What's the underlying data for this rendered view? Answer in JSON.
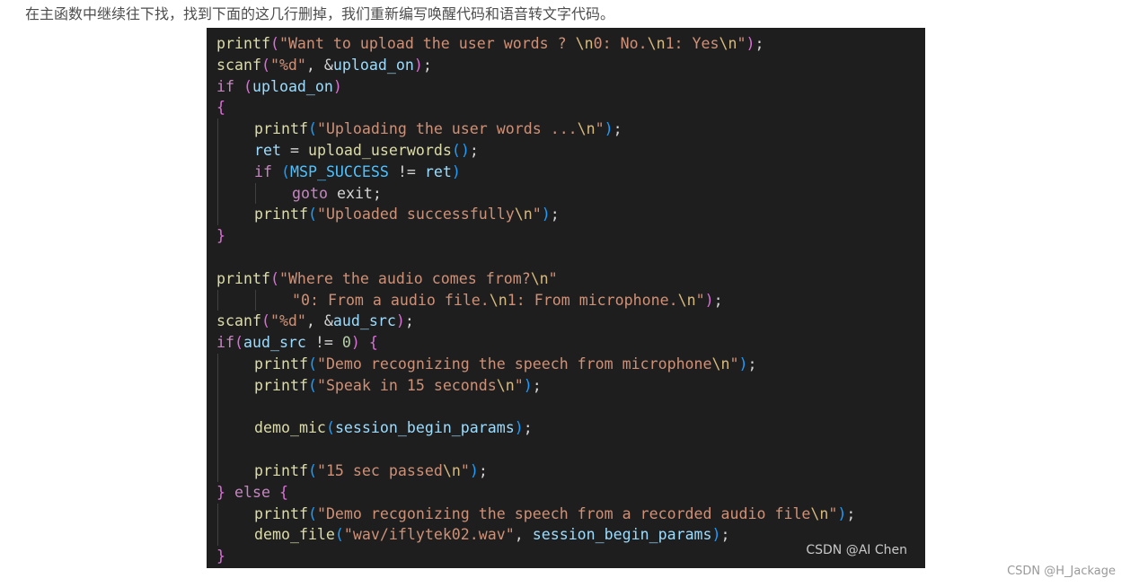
{
  "intro_text": "在主函数中继续往下找，找到下面的这几行删掉，我们重新编写唤醒代码和语音转文字代码。",
  "watermark_image": "CSDN @AI Chen",
  "watermark_page": "CSDN @H_Jackage",
  "code_lines": [
    {
      "indent": 0,
      "tokens": [
        [
          "fn",
          "printf"
        ],
        [
          "br",
          "("
        ],
        [
          "str",
          "\"Want to upload the user words ? "
        ],
        [
          "esc",
          "\\n"
        ],
        [
          "str",
          "0: No."
        ],
        [
          "esc",
          "\\n"
        ],
        [
          "str",
          "1: Yes"
        ],
        [
          "esc",
          "\\n"
        ],
        [
          "str",
          "\""
        ],
        [
          "br",
          ")"
        ],
        [
          "p",
          ";"
        ]
      ]
    },
    {
      "indent": 0,
      "tokens": [
        [
          "fn",
          "scanf"
        ],
        [
          "br",
          "("
        ],
        [
          "str",
          "\"%d\""
        ],
        [
          "p",
          ", &"
        ],
        [
          "var",
          "upload_on"
        ],
        [
          "br",
          ")"
        ],
        [
          "p",
          ";"
        ]
      ]
    },
    {
      "indent": 0,
      "tokens": [
        [
          "kw",
          "if"
        ],
        [
          "p",
          " "
        ],
        [
          "br",
          "("
        ],
        [
          "var",
          "upload_on"
        ],
        [
          "br",
          ")"
        ]
      ]
    },
    {
      "indent": 0,
      "tokens": [
        [
          "br",
          "{"
        ]
      ]
    },
    {
      "indent": 1,
      "tokens": [
        [
          "fn",
          "printf"
        ],
        [
          "br2",
          "("
        ],
        [
          "str",
          "\"Uploading the user words ..."
        ],
        [
          "esc",
          "\\n"
        ],
        [
          "str",
          "\""
        ],
        [
          "br2",
          ")"
        ],
        [
          "p",
          ";"
        ]
      ]
    },
    {
      "indent": 1,
      "tokens": [
        [
          "var",
          "ret"
        ],
        [
          "p",
          " = "
        ],
        [
          "fn",
          "upload_userwords"
        ],
        [
          "br2",
          "()"
        ],
        [
          "p",
          ";"
        ]
      ]
    },
    {
      "indent": 1,
      "tokens": [
        [
          "kw",
          "if"
        ],
        [
          "p",
          " "
        ],
        [
          "br2",
          "("
        ],
        [
          "const",
          "MSP_SUCCESS"
        ],
        [
          "p",
          " != "
        ],
        [
          "var",
          "ret"
        ],
        [
          "br2",
          ")"
        ]
      ]
    },
    {
      "indent": 2,
      "tokens": [
        [
          "kw",
          "goto"
        ],
        [
          "p",
          " exit;"
        ]
      ]
    },
    {
      "indent": 1,
      "tokens": [
        [
          "fn",
          "printf"
        ],
        [
          "br2",
          "("
        ],
        [
          "str",
          "\"Uploaded successfully"
        ],
        [
          "esc",
          "\\n"
        ],
        [
          "str",
          "\""
        ],
        [
          "br2",
          ")"
        ],
        [
          "p",
          ";"
        ]
      ]
    },
    {
      "indent": 0,
      "tokens": [
        [
          "br",
          "}"
        ]
      ]
    },
    {
      "indent": 0,
      "tokens": []
    },
    {
      "indent": 0,
      "tokens": [
        [
          "fn",
          "printf"
        ],
        [
          "br",
          "("
        ],
        [
          "str",
          "\"Where the audio comes from?"
        ],
        [
          "esc",
          "\\n"
        ],
        [
          "str",
          "\""
        ]
      ]
    },
    {
      "indent": 2,
      "tokens": [
        [
          "str",
          "\"0: From a audio file."
        ],
        [
          "esc",
          "\\n"
        ],
        [
          "str",
          "1: From microphone."
        ],
        [
          "esc",
          "\\n"
        ],
        [
          "str",
          "\""
        ],
        [
          "br",
          ")"
        ],
        [
          "p",
          ";"
        ]
      ]
    },
    {
      "indent": 0,
      "tokens": [
        [
          "fn",
          "scanf"
        ],
        [
          "br",
          "("
        ],
        [
          "str",
          "\"%d\""
        ],
        [
          "p",
          ", &"
        ],
        [
          "var",
          "aud_src"
        ],
        [
          "br",
          ")"
        ],
        [
          "p",
          ";"
        ]
      ]
    },
    {
      "indent": 0,
      "tokens": [
        [
          "kw",
          "if"
        ],
        [
          "br",
          "("
        ],
        [
          "var",
          "aud_src"
        ],
        [
          "p",
          " != "
        ],
        [
          "num",
          "0"
        ],
        [
          "br",
          ")"
        ],
        [
          "p",
          " "
        ],
        [
          "br",
          "{"
        ]
      ]
    },
    {
      "indent": 1,
      "tokens": [
        [
          "fn",
          "printf"
        ],
        [
          "br2",
          "("
        ],
        [
          "str",
          "\"Demo recognizing the speech from microphone"
        ],
        [
          "esc",
          "\\n"
        ],
        [
          "str",
          "\""
        ],
        [
          "br2",
          ")"
        ],
        [
          "p",
          ";"
        ]
      ]
    },
    {
      "indent": 1,
      "tokens": [
        [
          "fn",
          "printf"
        ],
        [
          "br2",
          "("
        ],
        [
          "str",
          "\"Speak in 15 seconds"
        ],
        [
          "esc",
          "\\n"
        ],
        [
          "str",
          "\""
        ],
        [
          "br2",
          ")"
        ],
        [
          "p",
          ";"
        ]
      ]
    },
    {
      "indent": 1,
      "tokens": []
    },
    {
      "indent": 1,
      "tokens": [
        [
          "fn",
          "demo_mic"
        ],
        [
          "br2",
          "("
        ],
        [
          "var",
          "session_begin_params"
        ],
        [
          "br2",
          ")"
        ],
        [
          "p",
          ";"
        ]
      ]
    },
    {
      "indent": 1,
      "tokens": []
    },
    {
      "indent": 1,
      "tokens": [
        [
          "fn",
          "printf"
        ],
        [
          "br2",
          "("
        ],
        [
          "str",
          "\"15 sec passed"
        ],
        [
          "esc",
          "\\n"
        ],
        [
          "str",
          "\""
        ],
        [
          "br2",
          ")"
        ],
        [
          "p",
          ";"
        ]
      ]
    },
    {
      "indent": 0,
      "tokens": [
        [
          "br",
          "}"
        ],
        [
          "p",
          " "
        ],
        [
          "kw",
          "else"
        ],
        [
          "p",
          " "
        ],
        [
          "br",
          "{"
        ]
      ]
    },
    {
      "indent": 1,
      "tokens": [
        [
          "fn",
          "printf"
        ],
        [
          "br2",
          "("
        ],
        [
          "str",
          "\"Demo recgonizing the speech from a recorded audio file"
        ],
        [
          "esc",
          "\\n"
        ],
        [
          "str",
          "\""
        ],
        [
          "br2",
          ")"
        ],
        [
          "p",
          ";"
        ]
      ]
    },
    {
      "indent": 1,
      "tokens": [
        [
          "fn",
          "demo_file"
        ],
        [
          "br2",
          "("
        ],
        [
          "str",
          "\"wav/iflytek02.wav\""
        ],
        [
          "p",
          ", "
        ],
        [
          "var",
          "session_begin_params"
        ],
        [
          "br2",
          ")"
        ],
        [
          "p",
          ";"
        ]
      ]
    },
    {
      "indent": 0,
      "tokens": [
        [
          "br",
          "}"
        ]
      ]
    }
  ]
}
